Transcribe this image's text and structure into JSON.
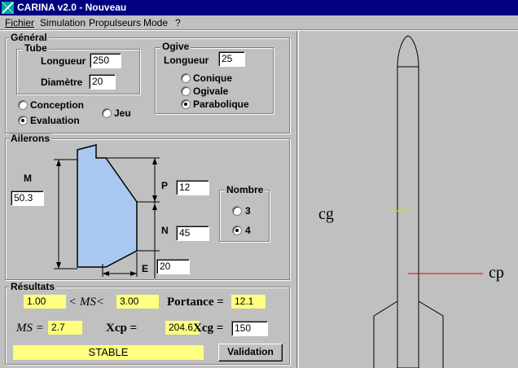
{
  "window": {
    "title": "CARINA v2.0 - Nouveau"
  },
  "menu": [
    {
      "label": "Fichier"
    },
    {
      "label": "Simulation"
    },
    {
      "label": "Propulseurs"
    },
    {
      "label": "Mode"
    },
    {
      "label": "?"
    }
  ],
  "general": {
    "title": "Général",
    "tube": {
      "title": "Tube",
      "longueur_label": "Longueur",
      "longueur_value": "250",
      "diametre_label": "Diamètre",
      "diametre_value": "20"
    },
    "ogive": {
      "title": "Ogive",
      "longueur_label": "Longueur",
      "longueur_value": "25",
      "options": [
        {
          "label": "Conique",
          "checked": false
        },
        {
          "label": "Ogivale",
          "checked": false
        },
        {
          "label": "Parabolique",
          "checked": true
        }
      ]
    },
    "mode_options": {
      "conception": "Conception",
      "evaluation": "Evaluation",
      "jeu": "Jeu"
    }
  },
  "ailerons": {
    "title": "Ailerons",
    "m_label": "M",
    "m_value": "50.3",
    "p_label": "P",
    "p_value": "12",
    "n_label": "N",
    "n_value": "45",
    "e_label": "E",
    "e_value": "20",
    "fin_color": "#a8c8f0",
    "nombre": {
      "title": "Nombre",
      "options": [
        {
          "label": "3",
          "checked": false
        },
        {
          "label": "4",
          "checked": true
        }
      ]
    }
  },
  "resultats": {
    "title": "Résultats",
    "ms_min": "1.00",
    "ms_range_label": "< MS<",
    "ms_max": "3.00",
    "portance_label": "Portance =",
    "portance_value": "12.1",
    "ms_label": "MS =",
    "ms_value": "2.7",
    "xcp_label": "Xcp =",
    "xcp_value": "204.6",
    "xcg_label": "Xcg =",
    "xcg_value": "150",
    "status": "STABLE",
    "validation_label": "Validation"
  },
  "rocket_view": {
    "cg_label": "cg",
    "cp_label": "cp",
    "cg_color": "#e0e000",
    "cp_color": "#e00000"
  }
}
